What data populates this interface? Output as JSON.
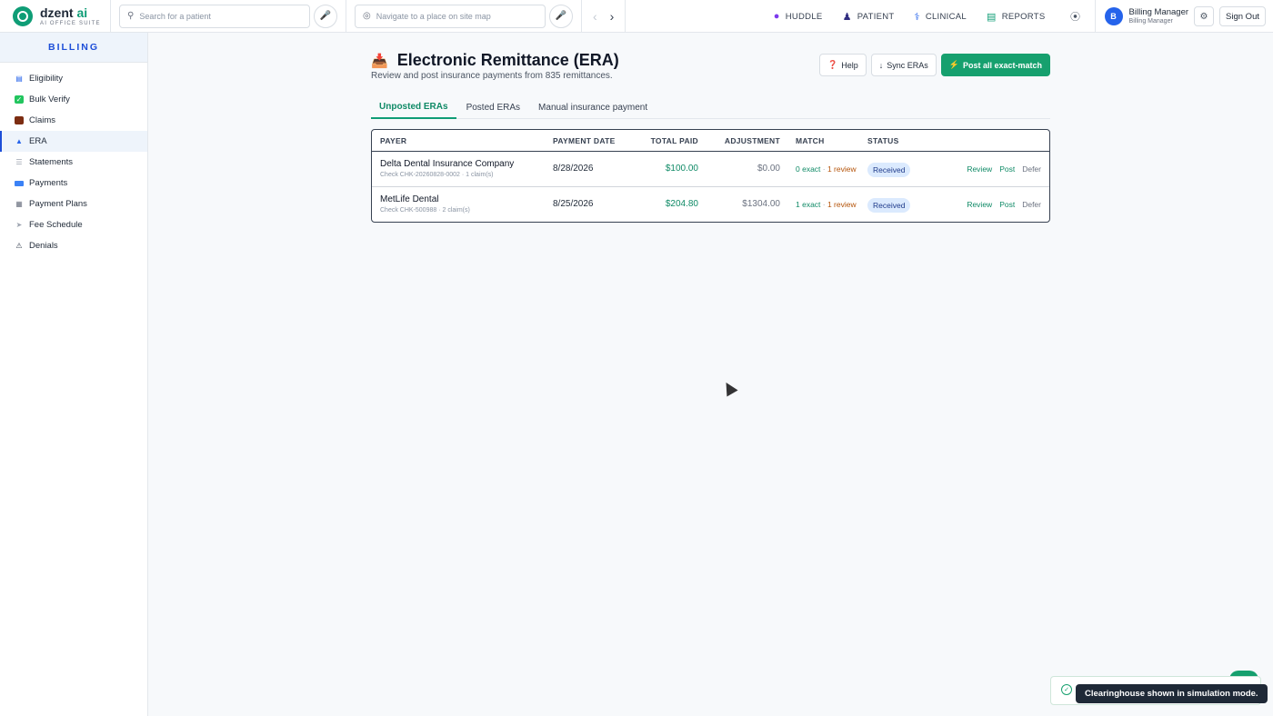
{
  "brand": {
    "name_prefix": "dzent",
    "name_suffix": " ai",
    "tagline": "AI OFFICE SUITE"
  },
  "topbar": {
    "patient_search_placeholder": "Search for a patient",
    "navigate_placeholder": "Navigate to a place on site map",
    "menu": [
      {
        "label": "HUDDLE",
        "icon": "huddle-icon"
      },
      {
        "label": "PATIENT",
        "icon": "patient-icon"
      },
      {
        "label": "CLINICAL",
        "icon": "stethoscope-icon"
      },
      {
        "label": "REPORTS",
        "icon": "reports-chart-icon"
      }
    ],
    "user": {
      "initial": "B",
      "name": "Billing Manager",
      "role": "Billing Manager"
    },
    "sign_out": "Sign Out"
  },
  "sidebar": {
    "title": "BILLING",
    "items": [
      {
        "label": "Eligibility",
        "icon": "id-card-icon"
      },
      {
        "label": "Bulk Verify",
        "icon": "checkbox-icon"
      },
      {
        "label": "Claims",
        "icon": "briefcase-icon"
      },
      {
        "label": "ERA",
        "icon": "inbox-tray-icon",
        "active": true
      },
      {
        "label": "Statements",
        "icon": "document-icon"
      },
      {
        "label": "Payments",
        "icon": "credit-card-icon"
      },
      {
        "label": "Payment Plans",
        "icon": "calendar-icon"
      },
      {
        "label": "Fee Schedule",
        "icon": "tag-icon"
      },
      {
        "label": "Denials",
        "icon": "warning-icon"
      }
    ]
  },
  "page": {
    "title": "Electronic Remittance (ERA)",
    "subtitle": "Review and post insurance payments from 835 remittances.",
    "help_label": "Help",
    "sync_label": "Sync ERAs",
    "post_all_label": "Post all exact-match"
  },
  "tabs": [
    {
      "label": "Unposted ERAs",
      "active": true
    },
    {
      "label": "Posted ERAs"
    },
    {
      "label": "Manual insurance payment"
    }
  ],
  "table": {
    "headers": [
      "PAYER",
      "PAYMENT DATE",
      "TOTAL PAID",
      "ADJUSTMENT",
      "MATCH",
      "STATUS"
    ],
    "rows": [
      {
        "payer": "Delta Dental Insurance Company",
        "check": "Check CHK-20260828-0002 · 1 claim(s)",
        "date": "8/28/2026",
        "total": "$100.00",
        "adjustment": "$0.00",
        "match_exact": "0 exact",
        "match_sep": " · ",
        "match_review": "1 review",
        "status": "Received",
        "actions": [
          "Review",
          "Post",
          "Defer"
        ]
      },
      {
        "payer": "MetLife Dental",
        "check": "Check CHK-500988 · 2 claim(s)",
        "date": "8/25/2026",
        "total": "$204.80",
        "adjustment": "$1304.00",
        "match_exact": "1 exact",
        "match_sep": " · ",
        "match_review": "1 review",
        "status": "Received",
        "actions": [
          "Review",
          "Post",
          "Defer"
        ]
      }
    ]
  },
  "toast": {
    "message": "Clearinghouse shown in simulation mode."
  },
  "colors": {
    "accent": "#0f9d76",
    "primary_button": "#16a06e",
    "nav_active": "#1d4ed8"
  }
}
